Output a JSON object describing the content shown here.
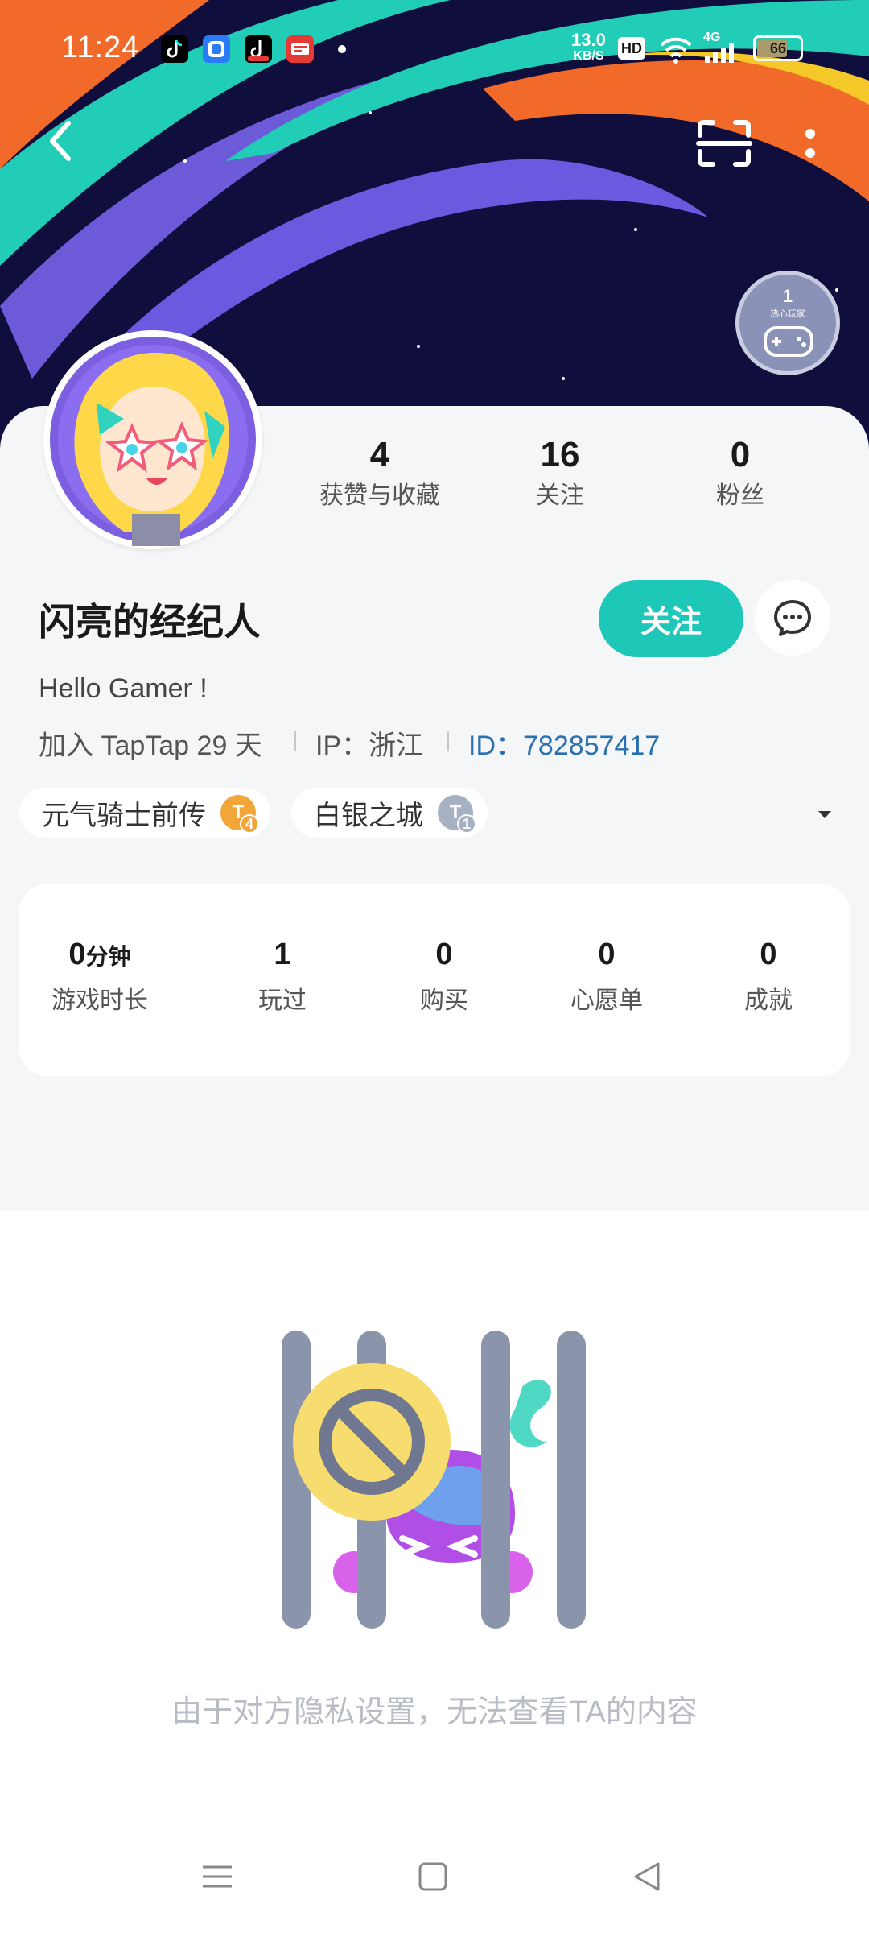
{
  "status_bar": {
    "time": "11:24",
    "network_speed_value": "13.0",
    "network_speed_unit": "KB/S",
    "hd": "HD",
    "network_type": "4G",
    "battery": "66"
  },
  "header": {
    "achievement_badge_count": "1",
    "achievement_badge_label": "热心玩家"
  },
  "stats": [
    {
      "value": "4",
      "label": "获赞与收藏"
    },
    {
      "value": "16",
      "label": "关注"
    },
    {
      "value": "0",
      "label": "粉丝"
    }
  ],
  "profile": {
    "username": "闪亮的经纪人",
    "follow_label": "关注",
    "bio": "Hello Gamer !",
    "joined": "加入 TapTap 29 天",
    "ip": "IP：浙江",
    "id_label": "ID：",
    "id_value": "782857417"
  },
  "games": [
    {
      "name": "元气骑士前传",
      "badge": "4"
    },
    {
      "name": "白银之城",
      "badge": "1"
    }
  ],
  "summary": [
    {
      "value": "0",
      "unit": "分钟",
      "label": "游戏时长"
    },
    {
      "value": "1",
      "unit": "",
      "label": "玩过"
    },
    {
      "value": "0",
      "unit": "",
      "label": "购买"
    },
    {
      "value": "0",
      "unit": "",
      "label": "心愿单"
    },
    {
      "value": "0",
      "unit": "",
      "label": "成就"
    }
  ],
  "private_message": "由于对方隐私设置，无法查看TA的内容",
  "colors": {
    "accent": "#1ec8b8",
    "id_blue": "#2a6fb0",
    "header_bg": "#0f0d3a"
  }
}
